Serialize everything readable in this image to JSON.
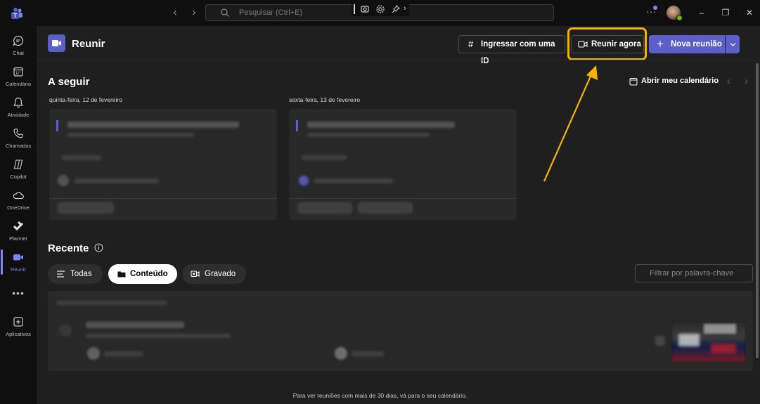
{
  "titlebar": {
    "search_placeholder": "Pesquisar (Ctrl+E)"
  },
  "sidebar": {
    "items": [
      {
        "label": "Chat",
        "icon": "chat-icon"
      },
      {
        "label": "Calendário",
        "icon": "calendar-icon"
      },
      {
        "label": "Atividade",
        "icon": "bell-icon"
      },
      {
        "label": "Chamadas",
        "icon": "phone-icon"
      },
      {
        "label": "Copilot",
        "icon": "copilot-icon"
      },
      {
        "label": "OneDrive",
        "icon": "cloud-icon"
      },
      {
        "label": "Planner",
        "icon": "planner-icon"
      },
      {
        "label": "Reunir",
        "icon": "video-icon"
      },
      {
        "label": "Aplicativos",
        "icon": "add-apps-icon"
      }
    ],
    "more_label": "•••"
  },
  "header": {
    "title": "Reunir",
    "join_with_id": "Ingressar com uma ID",
    "meet_now": "Reunir agora",
    "new_meeting": "Nova reunião"
  },
  "upcoming": {
    "title": "A seguir",
    "open_calendar": "Abrir meu calendário",
    "day1": "quinta-feira, 12 de fevereiro",
    "day2": "sexta-feira, 13 de fevereiro"
  },
  "recent": {
    "title": "Recente",
    "filters": [
      "Todas",
      "Conteúdo",
      "Gravado"
    ],
    "selected_filter": "Conteúdo",
    "keyword_placeholder": "Filtrar por palavra-chave"
  },
  "footer": {
    "note": "Para ver reuniões com mais de 30 dias, vá para o seu calendário."
  },
  "colors": {
    "accent": "#5b5fc7",
    "accent_light": "#7f85f5",
    "highlight": "#f4b400",
    "background": "#1f1f1f",
    "rail": "#0f0f0f"
  }
}
